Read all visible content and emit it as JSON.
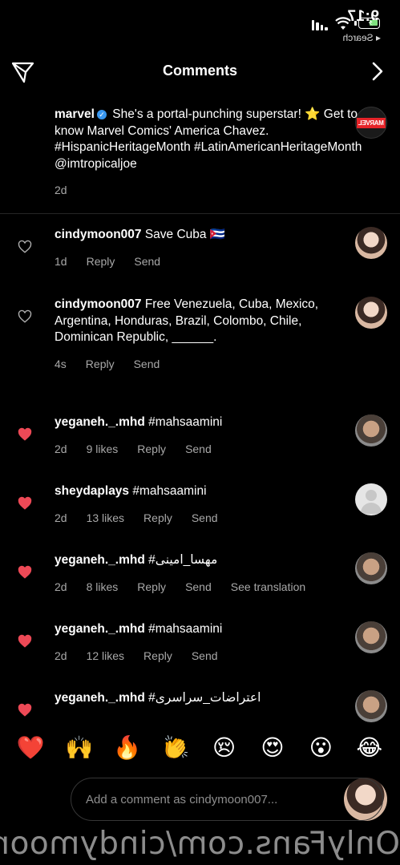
{
  "status_bar": {
    "time": "9:17",
    "back_label": "◂ Search"
  },
  "header": {
    "title": "Comments"
  },
  "caption": {
    "username": "marvel",
    "text": "She's a portal-punching superstar! ⭐ Get to know Marvel Comics' America Chavez. #HispanicHeritageMonth #LatinAmericanHeritageMonth @imtropicaljoe",
    "time": "2d"
  },
  "comments": [
    {
      "username": "cindymoon007",
      "text": "Save Cuba 🇨🇺",
      "time": "1d",
      "likes": "",
      "actions": [
        "Reply",
        "Send"
      ],
      "liked": false
    },
    {
      "username": "cindymoon007",
      "text": "Free Venezuela, Cuba, Mexico, Argentina, Honduras, Brazil, Colombo, Chile, Dominican Republic, ______.",
      "time": "4s",
      "likes": "",
      "actions": [
        "Reply",
        "Send"
      ],
      "liked": false
    },
    {
      "username": "yeganeh._.mhd",
      "text": "#mahsaamini",
      "time": "2d",
      "likes": "9 likes",
      "actions": [
        "Reply",
        "Send"
      ],
      "liked": true
    },
    {
      "username": "sheydaplays",
      "text": "#mahsaamini",
      "time": "2d",
      "likes": "13 likes",
      "actions": [
        "Reply",
        "Send"
      ],
      "liked": true
    },
    {
      "username": "yeganeh._.mhd",
      "text": "#مهسا_امینی",
      "time": "2d",
      "likes": "8 likes",
      "actions": [
        "Reply",
        "Send",
        "See translation"
      ],
      "liked": true
    },
    {
      "username": "yeganeh._.mhd",
      "text": "#mahsaamini",
      "time": "2d",
      "likes": "12 likes",
      "actions": [
        "Reply",
        "Send"
      ],
      "liked": true
    },
    {
      "username": "yeganeh._.mhd",
      "text": "#اعتراضات_سراسری",
      "time": "",
      "likes": "",
      "actions": [],
      "liked": true
    }
  ],
  "emoji_bar": [
    "❤️",
    "🙌",
    "🔥",
    "👏",
    "😢",
    "😍",
    "😮",
    "😂"
  ],
  "input": {
    "placeholder": "Add a comment as cindymoon007..."
  },
  "watermark": "OnlyFans.com/cindymoon",
  "colors": {
    "heart_liked": "#ed4956",
    "verified": "#3897f0",
    "muted": "#a8a8a8"
  }
}
